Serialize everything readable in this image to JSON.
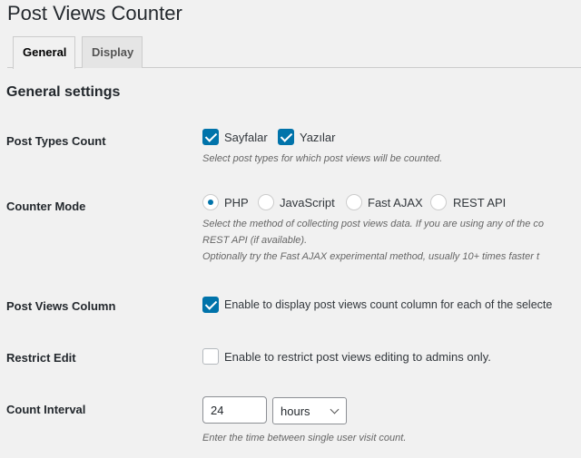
{
  "title": "Post Views Counter",
  "tabs": [
    {
      "label": "General",
      "active": true
    },
    {
      "label": "Display",
      "active": false
    }
  ],
  "section_title": "General settings",
  "accent": "#0073aa",
  "post_types": {
    "label": "Post Types Count",
    "options": [
      {
        "label": "Sayfalar",
        "checked": true
      },
      {
        "label": "Yazılar",
        "checked": true
      }
    ],
    "desc": "Select post types for which post views will be counted."
  },
  "counter_mode": {
    "label": "Counter Mode",
    "options": [
      {
        "label": "PHP",
        "selected": true
      },
      {
        "label": "JavaScript",
        "selected": false
      },
      {
        "label": "Fast AJAX",
        "selected": false
      },
      {
        "label": "REST API",
        "selected": false
      }
    ],
    "desc": [
      "Select the method of collecting post views data. If you are using any of the co",
      "REST API (if available).",
      "Optionally try the Fast AJAX experimental method, usually 10+ times faster t"
    ]
  },
  "post_views_column": {
    "label": "Post Views Column",
    "checked": true,
    "text": "Enable to display post views count column for each of the selecte"
  },
  "restrict_edit": {
    "label": "Restrict Edit",
    "checked": false,
    "text": "Enable to restrict post views editing to admins only."
  },
  "count_interval": {
    "label": "Count Interval",
    "value": "24",
    "unit": "hours",
    "desc": "Enter the time between single user visit count."
  }
}
